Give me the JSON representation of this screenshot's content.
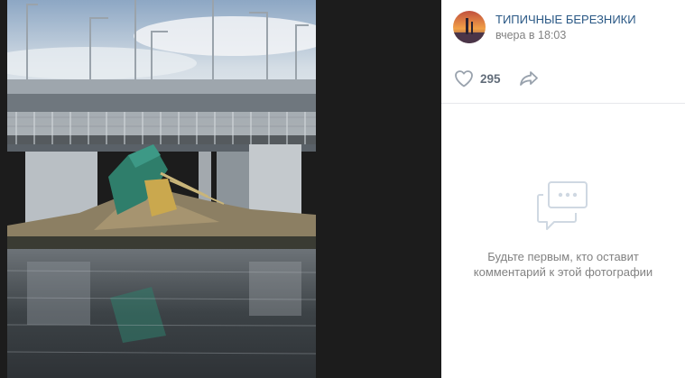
{
  "post": {
    "author": "ТИПИЧНЫЕ БЕРЕЗНИКИ",
    "time": "вчера в 18:03",
    "likes": "295"
  },
  "comments": {
    "empty_text": "Будьте первым, кто оставит комментарий к этой фотографии"
  },
  "icons": {
    "like": "heart-icon",
    "share": "share-arrow-icon",
    "comments_empty": "comments-bubble-icon"
  },
  "colors": {
    "link": "#2a5885",
    "muted": "#828282",
    "icon": "#99a2ad",
    "viewer_bg": "#1c1c1c"
  }
}
